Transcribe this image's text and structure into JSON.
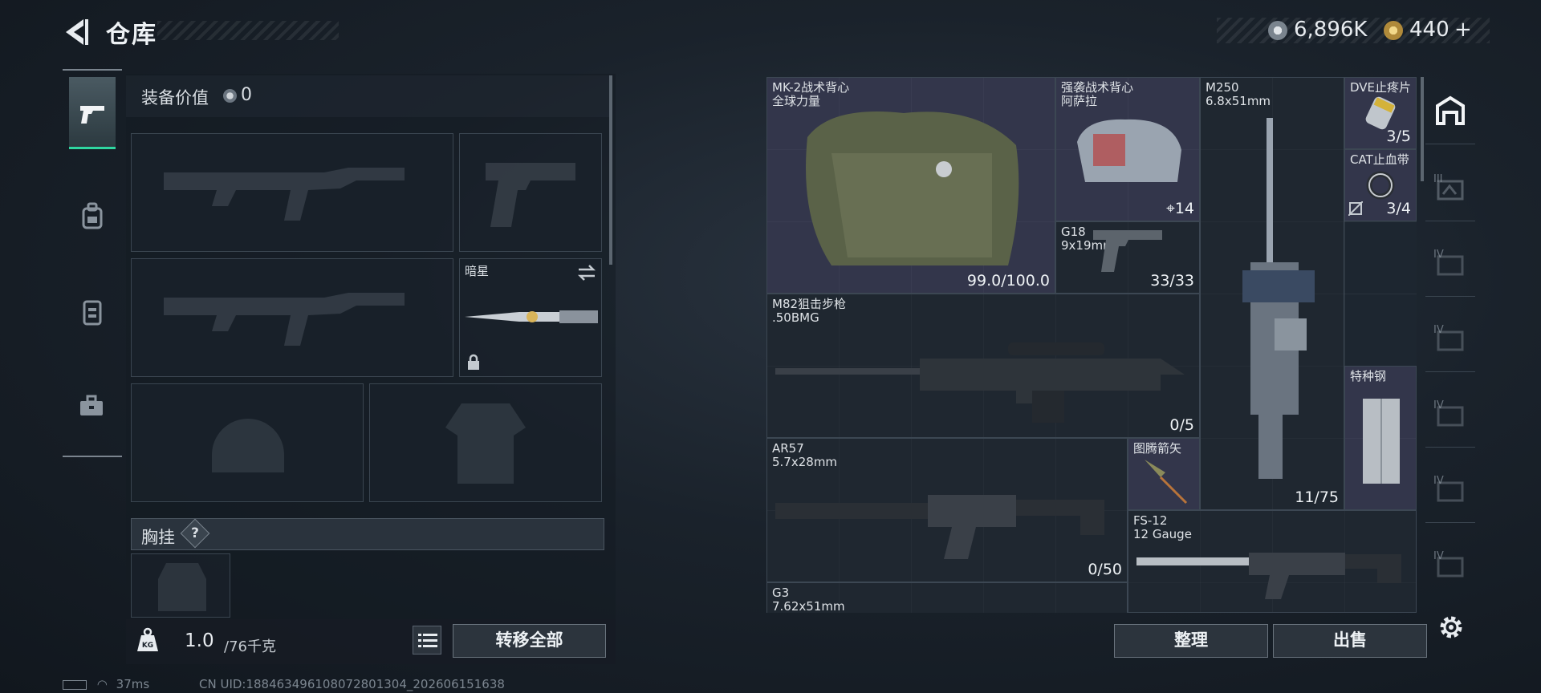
{
  "header": {
    "title": "仓库",
    "back_icon": "back-arrow-icon"
  },
  "currency": {
    "silver": "6,896K",
    "gold": "440",
    "gold_plus": "+"
  },
  "equipment": {
    "value_label": "装备价值",
    "value": "0",
    "melee_name": "暗星",
    "chest_label": "胸挂",
    "chest_help": "?"
  },
  "left_tabs": [
    {
      "name": "weapons",
      "icon": "pistol-icon"
    },
    {
      "name": "backpack",
      "icon": "backpack-icon"
    },
    {
      "name": "vest",
      "icon": "vest-icon"
    },
    {
      "name": "case",
      "icon": "toolbox-icon"
    }
  ],
  "weight": {
    "current": "1.0",
    "capacity": "/76千克"
  },
  "buttons": {
    "transfer_all": "转移全部",
    "sort": "整理",
    "sell": "出售"
  },
  "status": {
    "ping": "37ms",
    "uid": "CN UID:18846349610807280130​4_202606151638"
  },
  "items": [
    {
      "name": "MK-2战术背心",
      "sub": "全球力量",
      "count": "99.0/100.0"
    },
    {
      "name": "强袭战术背心",
      "sub": "阿萨拉",
      "count": "14"
    },
    {
      "name": "M250",
      "sub": "6.8x51mm",
      "count": "11/75"
    },
    {
      "name": "DVE止疼片",
      "sub": "",
      "count": "3/5"
    },
    {
      "name": "CAT止血带",
      "sub": "",
      "count": "3/4"
    },
    {
      "name": "G18",
      "sub": "9x19mm",
      "count": "33/33"
    },
    {
      "name": "M82狙击步枪",
      "sub": ".50BMG",
      "count": "0/5"
    },
    {
      "name": "特种钢",
      "sub": "",
      "count": ""
    },
    {
      "name": "AR57",
      "sub": "5.7x28mm",
      "count": "0/50"
    },
    {
      "name": "图腾箭矢",
      "sub": "",
      "count": ""
    },
    {
      "name": "FS-12",
      "sub": "12 Gauge",
      "count": ""
    },
    {
      "name": "G3",
      "sub": "7.62x51mm",
      "count": ""
    }
  ],
  "rail_tier": [
    "III",
    "IV",
    "IV",
    "IV",
    "IV",
    "IV"
  ],
  "colors": {
    "accent": "#2fd6a0",
    "highlight_cell": "#46445f"
  }
}
